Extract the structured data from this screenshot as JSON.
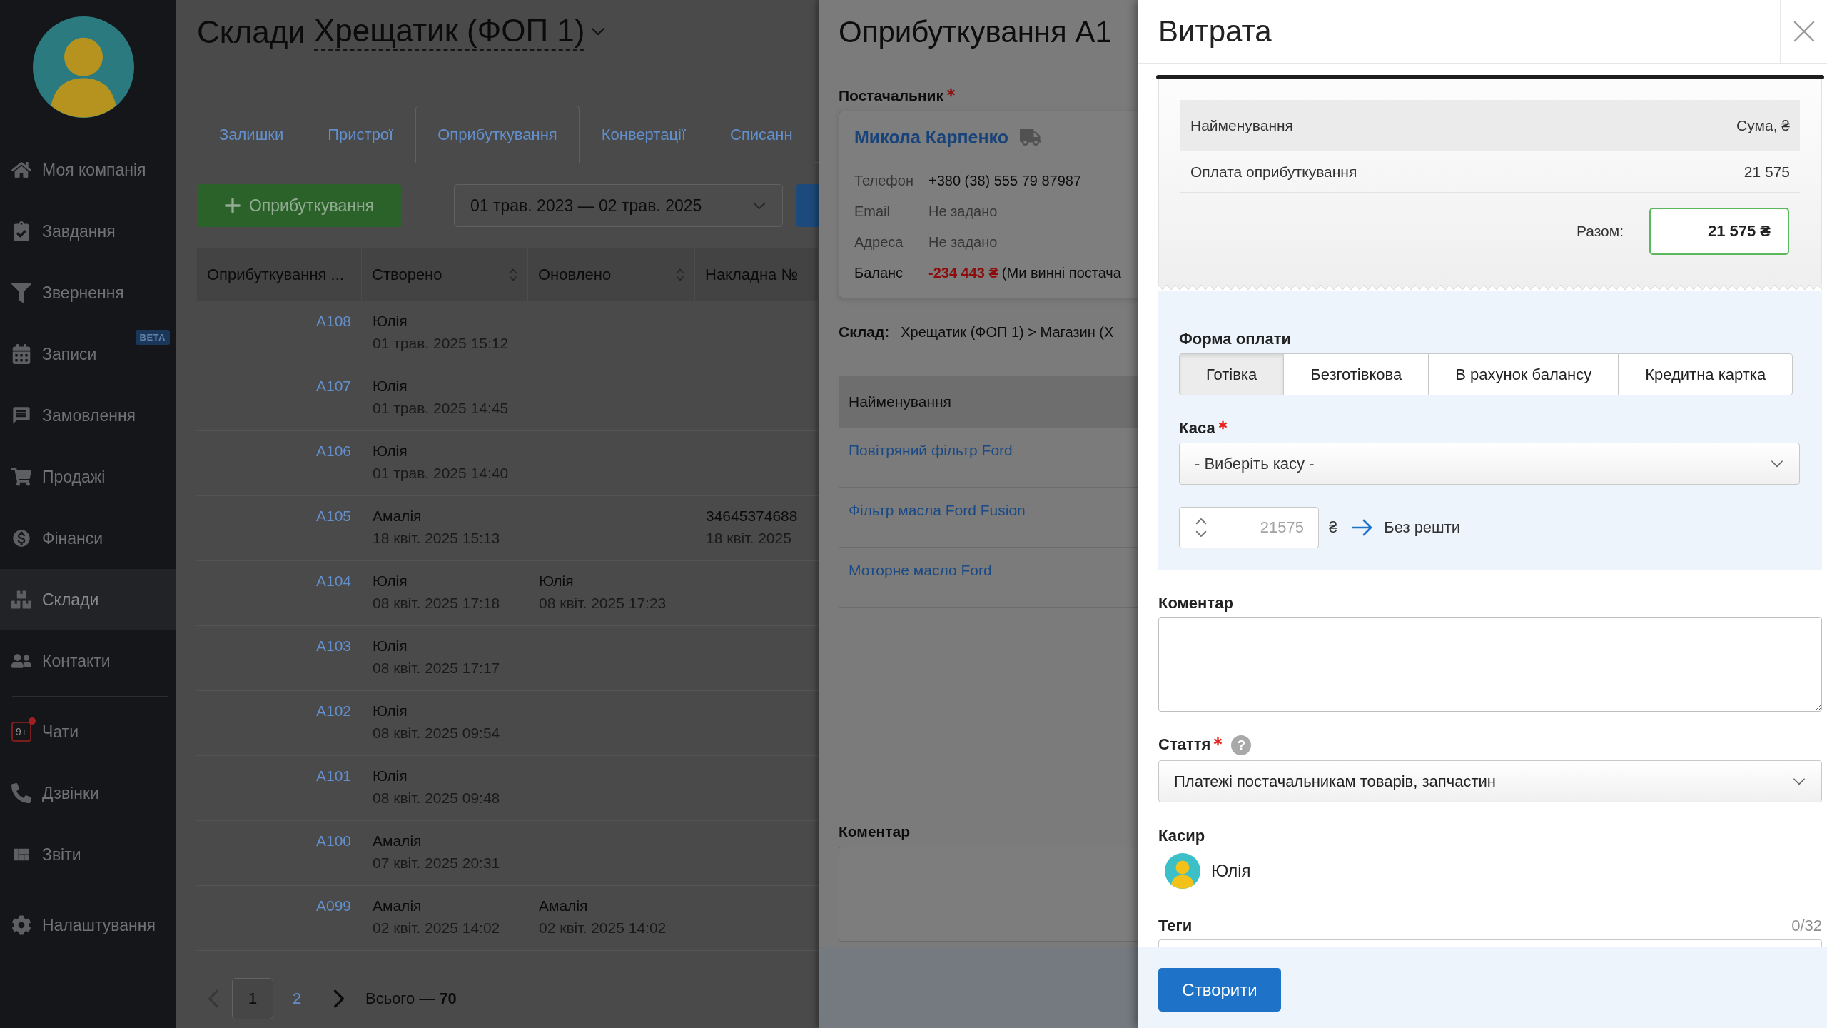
{
  "sidebar": {
    "groups": [
      {
        "items": [
          {
            "label": "Моя компанія",
            "selected": false
          },
          {
            "label": "Завдання",
            "selected": false
          },
          {
            "label": "Звернення",
            "selected": false
          },
          {
            "label": "Записи",
            "selected": false,
            "badge": "BETA"
          },
          {
            "label": "Замовлення",
            "selected": false
          },
          {
            "label": "Продажі",
            "selected": false
          },
          {
            "label": "Фінанси",
            "selected": false
          },
          {
            "label": "Склади",
            "selected": true
          },
          {
            "label": "Контакти",
            "selected": false
          }
        ]
      },
      {
        "items": [
          {
            "label": "Чати",
            "selected": false,
            "counter": "9+"
          },
          {
            "label": "Дзвінки",
            "selected": false
          },
          {
            "label": "Звіти",
            "selected": false
          }
        ]
      },
      {
        "items": [
          {
            "label": "Налаштування",
            "selected": false
          }
        ]
      }
    ]
  },
  "page_header": {
    "title": "Склади",
    "warehouse": "Хрещатик (ФОП 1)"
  },
  "tabs": [
    {
      "label": "Залишки",
      "selected": false
    },
    {
      "label": "Пристрої",
      "selected": false
    },
    {
      "label": "Оприбуткування",
      "selected": true
    },
    {
      "label": "Конвертації",
      "selected": false
    },
    {
      "label": "Списанн",
      "selected": false
    }
  ],
  "toolbar": {
    "add_button": "Оприбуткування",
    "date_range": "01 трав. 2023 — 02 трав. 2025"
  },
  "table": {
    "columns": [
      {
        "label": "Оприбуткування ...",
        "sortable": false
      },
      {
        "label": "Створено",
        "sortable": true
      },
      {
        "label": "Оновлено",
        "sortable": true
      },
      {
        "label": "Накладна №",
        "sortable": false
      }
    ],
    "rows": [
      {
        "number": "A108",
        "created_by": "Юлія",
        "created_at": "01 трав. 2025 15:12"
      },
      {
        "number": "A107",
        "created_by": "Юлія",
        "created_at": "01 трав. 2025 14:45"
      },
      {
        "number": "A106",
        "created_by": "Юлія",
        "created_at": "01 трав. 2025 14:40"
      },
      {
        "number": "A105",
        "created_by": "Амалія",
        "created_at": "18 квіт. 2025 15:13",
        "invoice_number": "34645374688",
        "invoice_date": "18 квіт. 2025"
      },
      {
        "number": "A104",
        "created_by": "Юлія",
        "created_at": "08 квіт. 2025 17:18",
        "updated_by": "Юлія",
        "updated_at": "08 квіт. 2025 17:23"
      },
      {
        "number": "A103",
        "created_by": "Юлія",
        "created_at": "08 квіт. 2025 17:17"
      },
      {
        "number": "A102",
        "created_by": "Юлія",
        "created_at": "08 квіт. 2025 09:54"
      },
      {
        "number": "A101",
        "created_by": "Юлія",
        "created_at": "08 квіт. 2025 09:48"
      },
      {
        "number": "A100",
        "created_by": "Амалія",
        "created_at": "07 квіт. 2025 20:31"
      },
      {
        "number": "A099",
        "created_by": "Амалія",
        "created_at": "02 квіт. 2025 14:02",
        "updated_by": "Амалія",
        "updated_at": "02 квіт. 2025 14:02"
      }
    ]
  },
  "pagination": {
    "previous": {
      "disabled": true
    },
    "pages": [
      {
        "label": "1",
        "selected": true
      },
      {
        "label": "2",
        "selected": false
      }
    ],
    "next": {
      "disabled": false
    },
    "total": "Всього — **70**"
  },
  "receipt_drawer": {
    "title": "Оприбуткування A1",
    "supplier_label": "Постачальник",
    "supplier_required": true,
    "supplier": {
      "name": "Микола Карпенко",
      "fields": [
        {
          "kind": "contact",
          "label": "Телефон",
          "value": "+380 (38) 555 79 87987"
        },
        {
          "kind": "unset",
          "label": "Email",
          "value": "Не задано"
        },
        {
          "kind": "unset",
          "label": "Адреса",
          "value": "Не задано"
        },
        {
          "kind": "balance",
          "label": "Баланс",
          "value": "-234 443 ₴",
          "note": "(Ми винні постача"
        }
      ]
    },
    "warehouse_label": "Склад:",
    "warehouse": "Хрещатик (ФОП 1) > Магазин (Х",
    "items_table": {
      "column": "Найменування",
      "rows": [
        "Повітряний фільтр Ford",
        "Фільтр масла Ford Fusion",
        "Моторне масло Ford"
      ]
    },
    "comment_label": "Коментар"
  },
  "expense_dialog": {
    "title": "Витрата",
    "receipt": {
      "columns": [
        "Найменування",
        "Сума, ₴"
      ],
      "rows": [
        {
          "name": "Оплата оприбуткування",
          "amount": "21 575"
        }
      ],
      "total_label": "Разом:",
      "total": "21 575 ₴"
    },
    "payment_form": {
      "label": "Форма оплати",
      "options": [
        {
          "label": "Готівка",
          "selected": true
        },
        {
          "label": "Безготівкова",
          "selected": false
        },
        {
          "label": "В рахунок балансу",
          "selected": false
        },
        {
          "label": "Кредитна картка",
          "selected": false
        }
      ]
    },
    "cash_desk": {
      "label": "Каса",
      "required": true,
      "placeholder": "- Виберіть касу -"
    },
    "amount": {
      "placeholder": "21575",
      "currency": "₴",
      "change": "Без решти"
    },
    "comment": {
      "label": "Коментар"
    },
    "category": {
      "label": "Стаття",
      "required": true,
      "help": "?",
      "value": "Платежі постачальникам товарів, запчастин"
    },
    "cashier": {
      "label": "Касир",
      "name": "Юлія"
    },
    "tags": {
      "label": "Теги",
      "counter": "0/32"
    },
    "submit": "Створити"
  }
}
